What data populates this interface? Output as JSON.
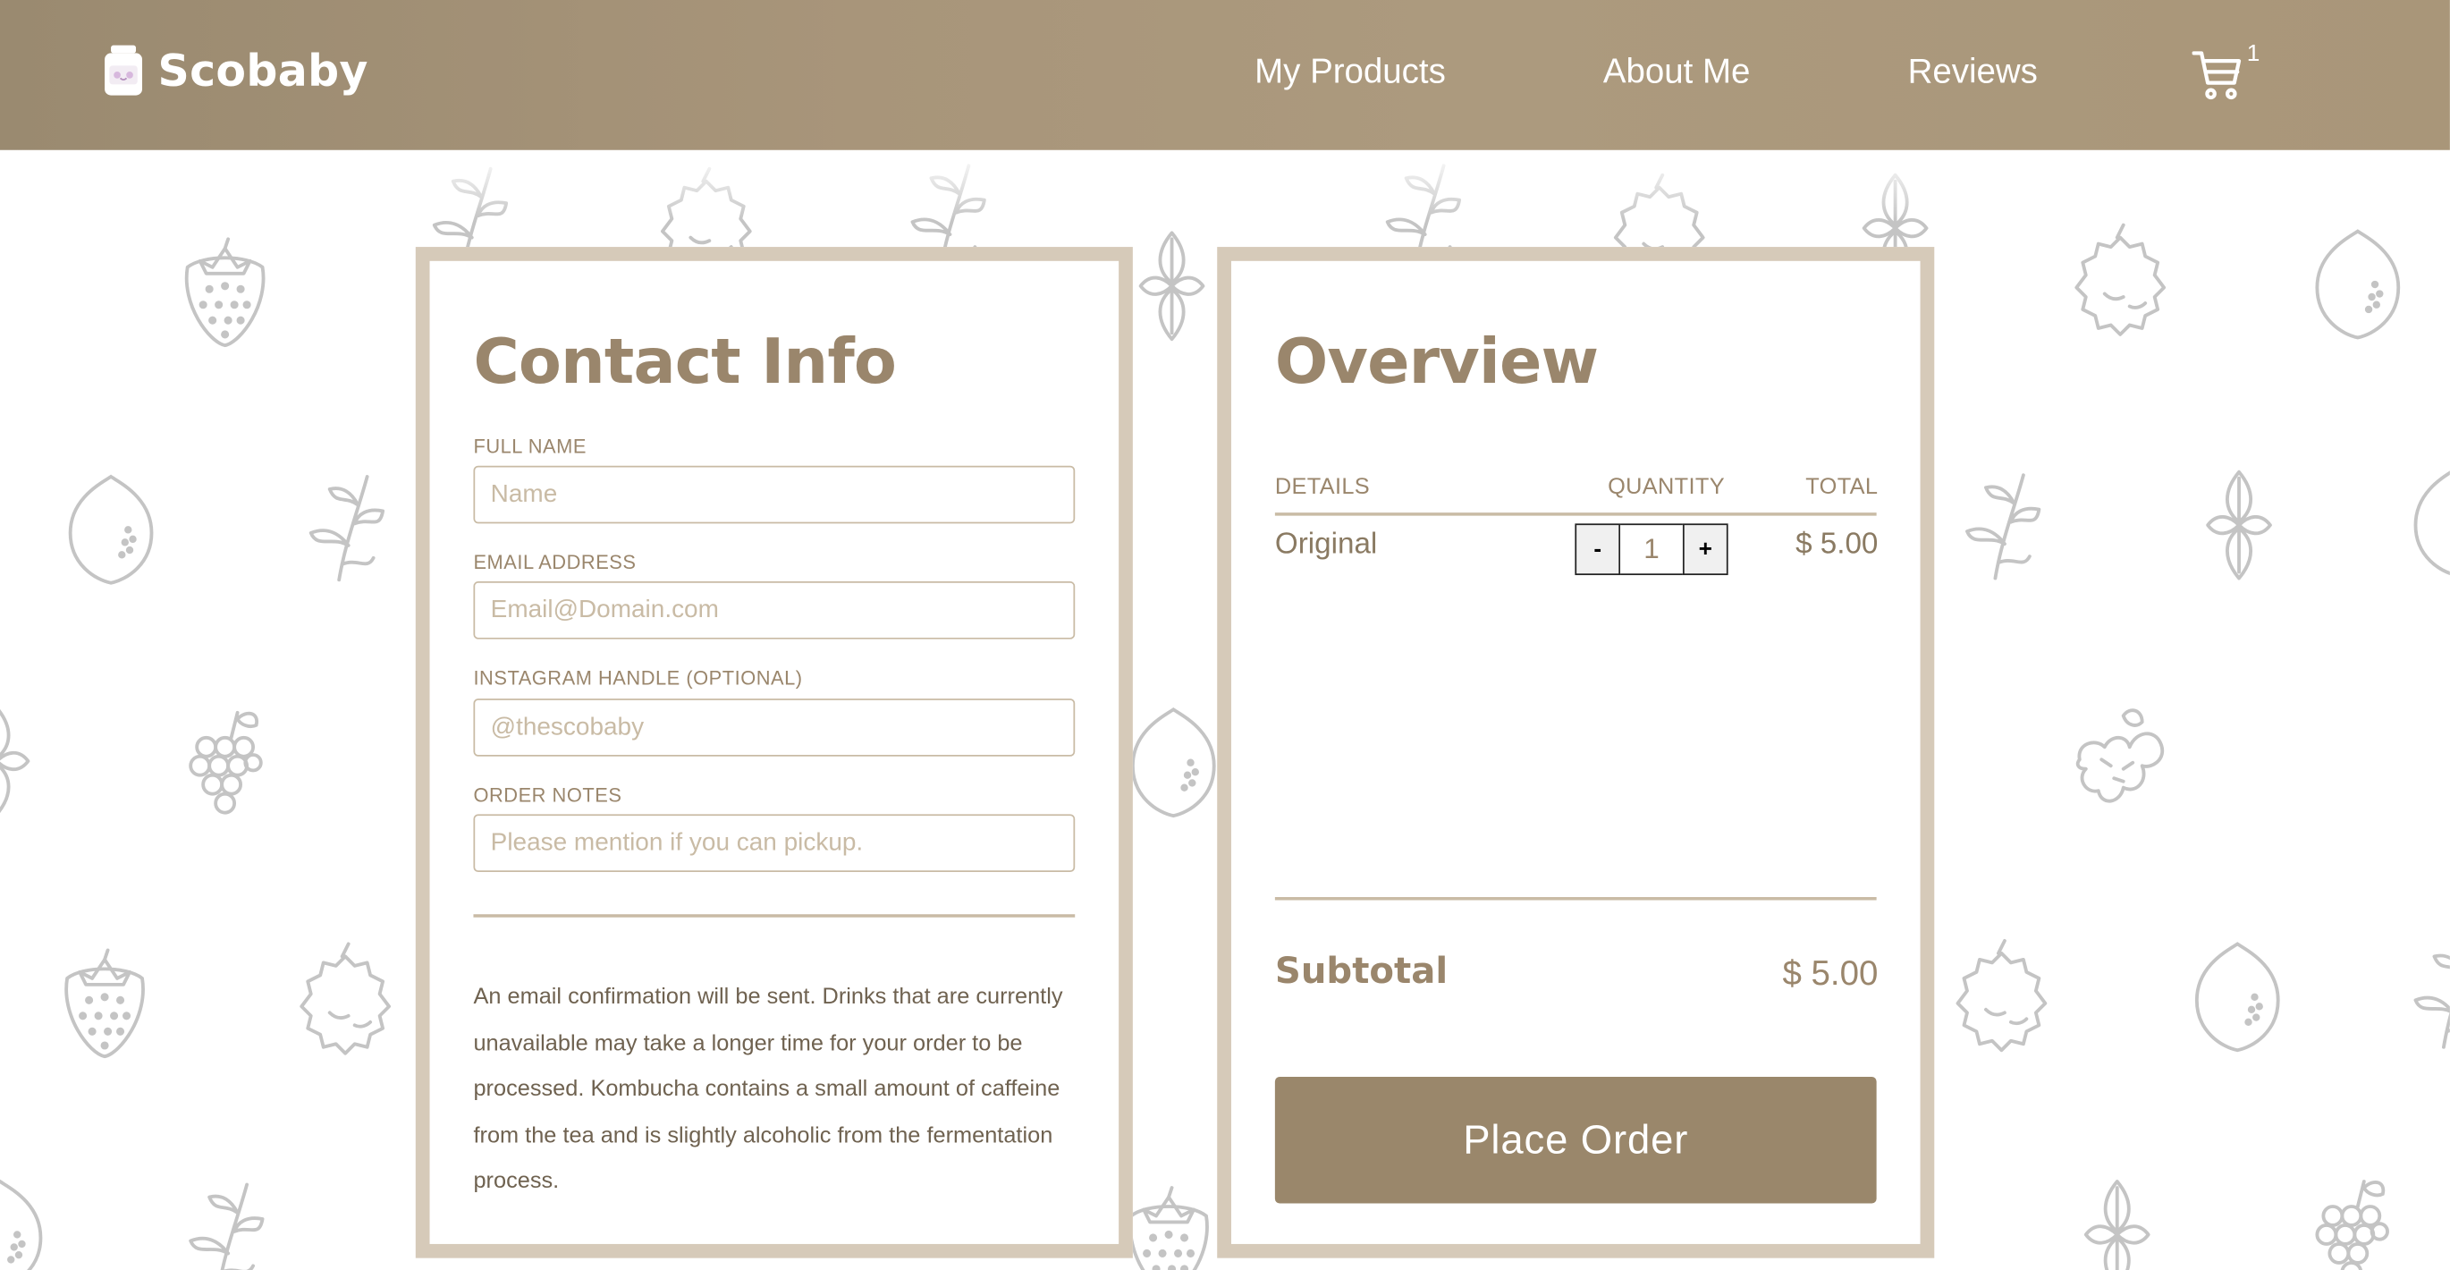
{
  "header": {
    "brand": "Scobaby",
    "nav": [
      "My Products",
      "About Me",
      "Reviews"
    ],
    "cart_count": "1"
  },
  "contact": {
    "title": "Contact Info",
    "fields": [
      {
        "label": "FULL NAME",
        "placeholder": "Name"
      },
      {
        "label": "EMAIL ADDRESS",
        "placeholder": "Email@Domain.com"
      },
      {
        "label": "INSTAGRAM HANDLE (OPTIONAL)",
        "placeholder": "@thescobaby"
      },
      {
        "label": "ORDER NOTES",
        "placeholder": "Please mention if you can pickup."
      }
    ],
    "notice": "An email confirmation will be sent. Drinks that are currently unavailable may take a longer time for your order to be processed. Kombucha contains a small amount of caffeine from the tea and is slightly alcoholic from the fermentation process."
  },
  "overview": {
    "title": "Overview",
    "columns": [
      "DETAILS",
      "QUANTITY",
      "TOTAL"
    ],
    "items": [
      {
        "name": "Original",
        "quantity": "1",
        "total": "$ 5.00"
      }
    ],
    "qty_minus": "-",
    "qty_plus": "+",
    "subtotal_label": "Subtotal",
    "subtotal_value": "$ 5.00",
    "place_order": "Place Order"
  },
  "colors": {
    "brand": "#a8957a",
    "accent": "#9a866c",
    "card_border": "#d6cab9",
    "pattern": "#c4c4c4"
  }
}
